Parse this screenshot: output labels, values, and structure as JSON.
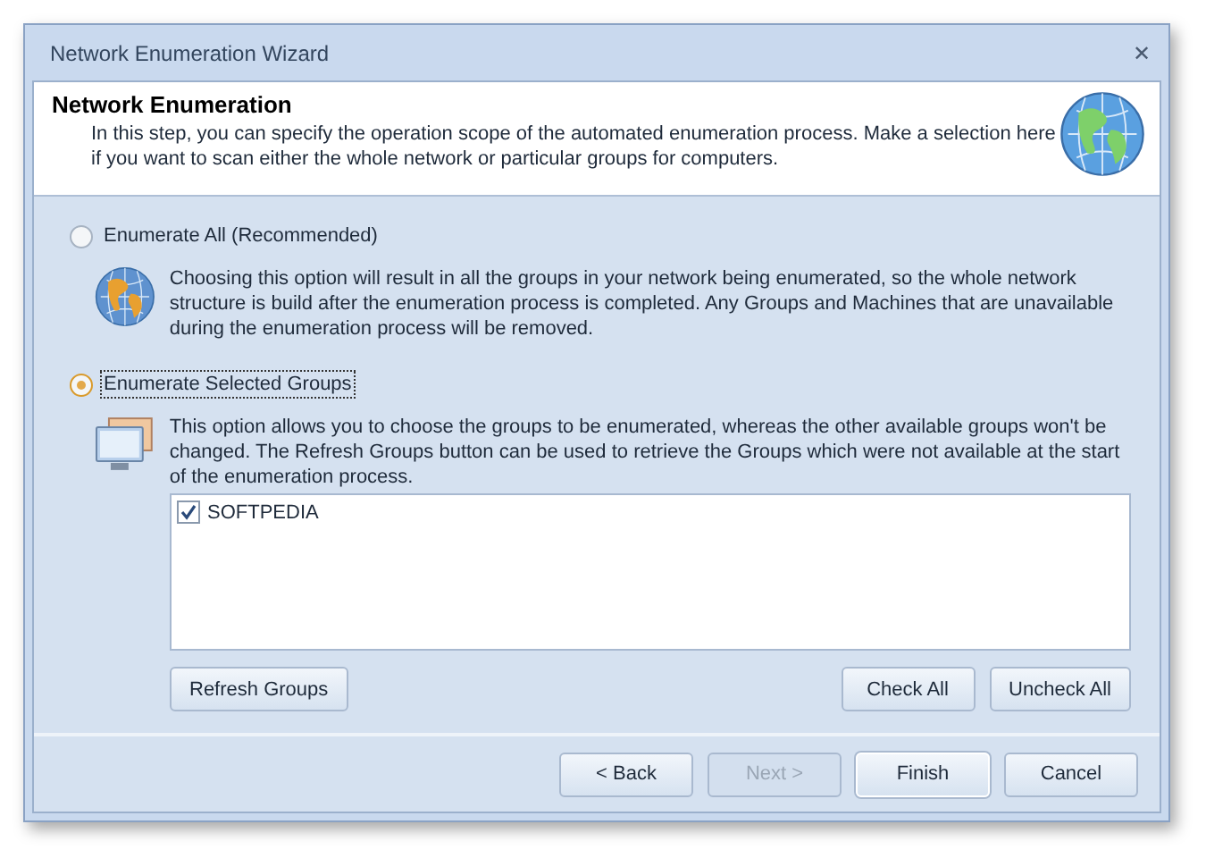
{
  "window": {
    "title": "Network Enumeration Wizard",
    "close": "✕"
  },
  "header": {
    "title": "Network Enumeration",
    "description": "In this step, you can specify the operation scope of the automated enumeration process. Make a selection here if you want to scan either the whole network or particular groups for computers."
  },
  "options": [
    {
      "kind": "globe",
      "label": "Enumerate All (Recommended)",
      "selected": false,
      "description": "Choosing this option will result in all the groups in your network being enumerated, so the whole network structure is build after the enumeration process is completed. Any Groups and Machines that are unavailable during the enumeration process will be removed."
    },
    {
      "kind": "monitor",
      "label": "Enumerate Selected Groups",
      "selected": true,
      "description": "This option allows you to choose the groups to be enumerated, whereas the other available groups won't be changed. The Refresh Groups button can be used to retrieve the Groups which were not available at the start of the enumeration process."
    }
  ],
  "groups": [
    {
      "label": "SOFTPEDIA",
      "checked": true
    }
  ],
  "group_buttons": {
    "left": "Refresh Groups",
    "right": [
      "Check All",
      "Uncheck All"
    ]
  },
  "footer_buttons": [
    {
      "label": "< Back",
      "disabled": false,
      "default": false
    },
    {
      "label": "Next >",
      "disabled": true,
      "default": false
    },
    {
      "label": "Finish",
      "disabled": false,
      "default": true
    },
    {
      "label": "Cancel",
      "disabled": false,
      "default": false
    }
  ]
}
